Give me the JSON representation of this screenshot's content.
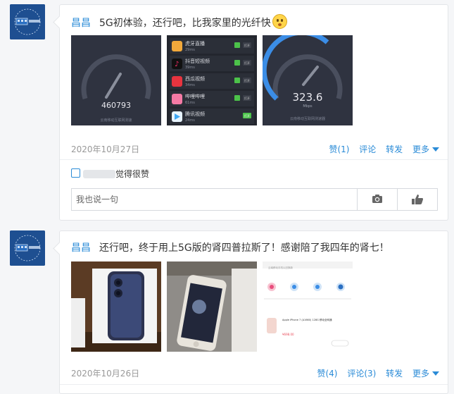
{
  "posts": [
    {
      "author": "昌昌",
      "content": "5G初体验，还行吧，比我家里的光纤快",
      "images": [
        {
          "alt": "speedtest-app-1",
          "text_a": "460793",
          "text_b": "云南移动互联网测速"
        },
        {
          "alt": "app-list",
          "apps": [
            {
              "name": "虎牙直播",
              "sub": "29ms",
              "btn": "打开"
            },
            {
              "name": "抖音短视频",
              "sub": "39ms",
              "btn": "打开"
            },
            {
              "name": "西瓜视频",
              "sub": "34ms",
              "btn": "打开"
            },
            {
              "name": "哔哩哔哩",
              "sub": "61ms",
              "btn": "打开"
            },
            {
              "name": "腾讯视频",
              "sub": "24ms",
              "btn": "打开"
            }
          ]
        },
        {
          "alt": "speedtest-app-2",
          "text_a": "323.6",
          "text_b": "Mbps",
          "text_c": "云南移动互联网测速器"
        }
      ],
      "date": "2020年10月27日",
      "actions": {
        "like": "赞(1)",
        "comment": "评论",
        "forward": "转发",
        "more": "更多"
      },
      "likes_text": "觉得很赞",
      "comment_placeholder": "我也说一句"
    },
    {
      "author": "昌昌",
      "content": "还行吧，终于用上5G版的肾四普拉斯了！感谢陪了我四年的肾七！",
      "images": [
        {
          "alt": "iphone-12-box"
        },
        {
          "alt": "old-iphone-7"
        },
        {
          "alt": "trade-in-screenshot",
          "t1": "云南移动手机以旧换新",
          "t2": "Apple iPhone 7 (A1660) 128G 移动全网通",
          "t3": "¥698.00"
        }
      ],
      "date": "2020年10月26日",
      "actions": {
        "like": "赞(4)",
        "comment": "评论(3)",
        "forward": "转发",
        "more": "更多"
      }
    }
  ],
  "colors": {
    "accent": "#2a8bd7",
    "date": "#999999",
    "avatar_bg": "#1e4f91"
  },
  "icons": {
    "camera": "camera-icon",
    "thumb": "thumbs-up-icon",
    "emoji": "pleading-face-emoji-icon"
  }
}
